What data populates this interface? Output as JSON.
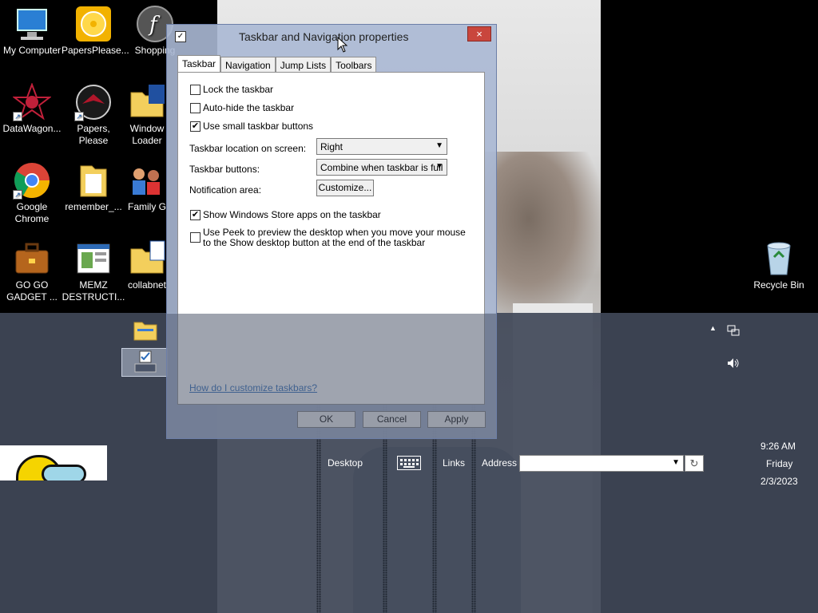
{
  "desktop": {
    "icons": [
      {
        "label": "My Computer",
        "icon": "computer-icon"
      },
      {
        "label": "PapersPlease...",
        "icon": "disc-icon"
      },
      {
        "label": "Shopping",
        "icon": "flash-icon"
      },
      {
        "label": "DataWagon...",
        "icon": "red-star-icon"
      },
      {
        "label": "Papers, Please",
        "icon": "eagle-icon"
      },
      {
        "label": "Window Loader",
        "icon": "folder-icon"
      },
      {
        "label": "Google Chrome",
        "icon": "chrome-icon"
      },
      {
        "label": "remember_...",
        "icon": "folder-icon"
      },
      {
        "label": "Family G",
        "icon": "family-icon"
      },
      {
        "label": "GO GO GADGET ...",
        "icon": "briefcase-icon"
      },
      {
        "label": "MEMZ DESTRUCTI...",
        "icon": "window-icon"
      },
      {
        "label": "collabnet",
        "icon": "folder-icon"
      },
      {
        "label": "Recycle Bin",
        "icon": "recycle-bin-icon"
      }
    ]
  },
  "dialog": {
    "title": "Taskbar and Navigation properties",
    "close": "×",
    "tabs": [
      "Taskbar",
      "Navigation",
      "Jump Lists",
      "Toolbars"
    ],
    "active_tab": "Taskbar",
    "options": {
      "lock": {
        "label": "Lock the taskbar",
        "checked": false
      },
      "autohide": {
        "label": "Auto-hide the taskbar",
        "checked": false
      },
      "small_buttons": {
        "label": "Use small taskbar buttons",
        "checked": true
      },
      "store_apps": {
        "label": "Show Windows Store apps on the taskbar",
        "checked": true
      },
      "peek": {
        "label": "Use Peek to preview the desktop when you move your mouse to the Show desktop button at the end of the taskbar",
        "checked": false
      }
    },
    "location_label": "Taskbar location on screen:",
    "location_value": "Right",
    "buttons_label": "Taskbar buttons:",
    "buttons_value": "Combine when taskbar is full",
    "notification_label": "Notification area:",
    "customize": "Customize...",
    "help_link": "How do I customize taskbars?",
    "ok": "OK",
    "cancel": "Cancel",
    "apply": "Apply"
  },
  "taskbar": {
    "overflow": "»",
    "desktop": "Desktop",
    "links": "Links",
    "address": "Address",
    "address_value": "",
    "time": "9:26 AM",
    "day": "Friday",
    "date": "2/3/2023"
  }
}
